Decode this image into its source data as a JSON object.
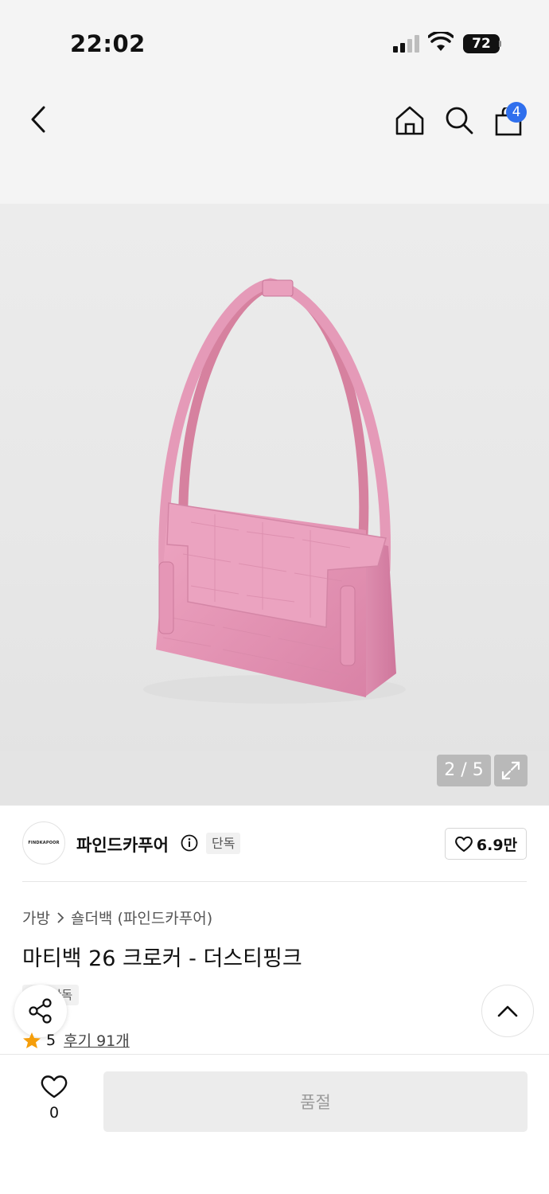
{
  "status_bar": {
    "time": "22:02",
    "battery": "72"
  },
  "nav": {
    "cart_count": "4"
  },
  "gallery": {
    "counter": "2 / 5"
  },
  "brand": {
    "logo_text": "FINDKAPOOR",
    "name": "파인드카푸어",
    "badge": "단독",
    "likes": "6.9만"
  },
  "product": {
    "breadcrumb": [
      "가방",
      "숄더백 (파인드카푸어)"
    ],
    "title": "마티백 26 크로커 - 더스티핑크",
    "tag_partial": "무신",
    "tag": "단독",
    "rating": "5",
    "reviews": "후기 91개"
  },
  "bottom": {
    "wish_count": "0",
    "buy_label": "품절"
  },
  "colors": {
    "accent_blue": "#2f6fed",
    "star": "#f59e0b",
    "bag_pink": "#e89ab8"
  }
}
